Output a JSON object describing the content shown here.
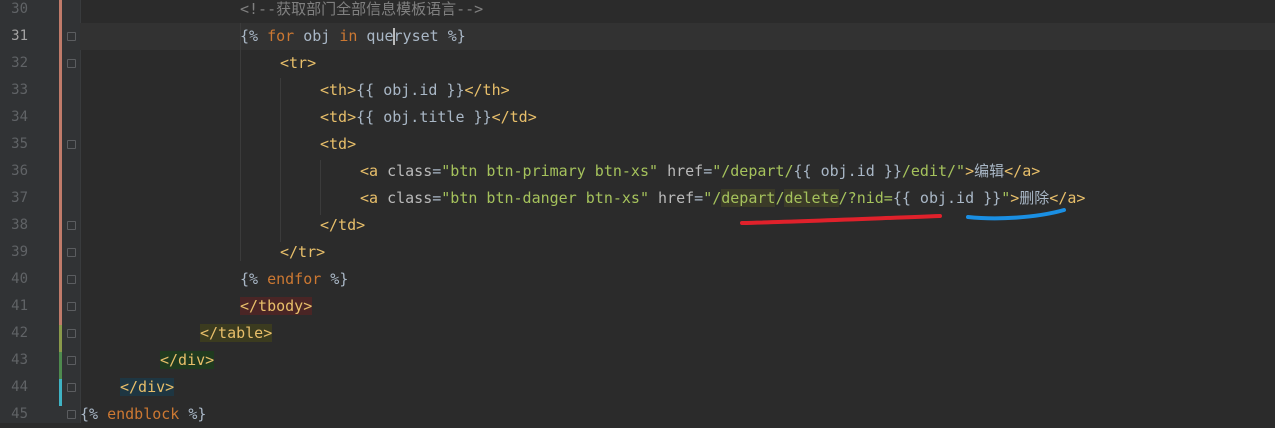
{
  "editor": {
    "current_line": 31,
    "line_numbers": [
      "30",
      "31",
      "32",
      "33",
      "34",
      "35",
      "36",
      "37",
      "38",
      "39",
      "40",
      "41",
      "42",
      "43",
      "44",
      "45"
    ],
    "lines": [
      {
        "segments": [
          [
            "comment",
            "<!--获取部门全部信息模板语言-->"
          ]
        ]
      },
      {
        "segments": [
          [
            "plain",
            "{% "
          ],
          [
            "kw",
            "for"
          ],
          [
            "plain",
            " obj "
          ],
          [
            "kw",
            "in"
          ],
          [
            "plain",
            " que"
          ],
          [
            "caret",
            ""
          ],
          [
            "plain",
            "ryset %}"
          ]
        ]
      },
      {
        "segments": [
          [
            "tag",
            "<tr>"
          ]
        ]
      },
      {
        "segments": [
          [
            "tag",
            "<th>"
          ],
          [
            "plain",
            "{{ obj.id }}"
          ],
          [
            "tag",
            "</th>"
          ]
        ]
      },
      {
        "segments": [
          [
            "tag",
            "<td>"
          ],
          [
            "plain",
            "{{ obj.title }}"
          ],
          [
            "tag",
            "</td>"
          ]
        ]
      },
      {
        "segments": [
          [
            "tag",
            "<td>"
          ]
        ]
      },
      {
        "segments": [
          [
            "tag",
            "<a "
          ],
          [
            "attr",
            "class"
          ],
          [
            "plain",
            "="
          ],
          [
            "val",
            "\"btn btn-primary btn-xs\""
          ],
          [
            "plain",
            " "
          ],
          [
            "attr",
            "href"
          ],
          [
            "plain",
            "="
          ],
          [
            "val",
            "\"/depart/"
          ],
          [
            "plain",
            "{{ obj.id }}"
          ],
          [
            "val",
            "/edit/\""
          ],
          [
            "tag",
            ">"
          ],
          [
            "plain",
            "编辑"
          ],
          [
            "tag",
            "</a>"
          ]
        ]
      },
      {
        "segments": [
          [
            "tag",
            "<a "
          ],
          [
            "attr",
            "class"
          ],
          [
            "plain",
            "="
          ],
          [
            "val",
            "\"btn btn-danger btn-xs\""
          ],
          [
            "plain",
            " "
          ],
          [
            "attr",
            "href"
          ],
          [
            "plain",
            "="
          ],
          [
            "val",
            "\"/"
          ],
          [
            "valhl",
            "depart"
          ],
          [
            "val",
            "/"
          ],
          [
            "valhl",
            "delete"
          ],
          [
            "val",
            "/?nid="
          ],
          [
            "plain",
            "{{ obj.id }}"
          ],
          [
            "val",
            "\""
          ],
          [
            "tag",
            ">"
          ],
          [
            "plain",
            "删除"
          ],
          [
            "tag",
            "</a>"
          ]
        ]
      },
      {
        "segments": [
          [
            "tag",
            "</td>"
          ]
        ]
      },
      {
        "segments": [
          [
            "tag",
            "</tr>"
          ]
        ]
      },
      {
        "segments": [
          [
            "plain",
            "{% "
          ],
          [
            "kw",
            "endfor"
          ],
          [
            "plain",
            " %}"
          ]
        ]
      },
      {
        "segments": [
          [
            "tbody",
            "</tbody>"
          ]
        ]
      },
      {
        "segments": [
          [
            "table",
            "</table>"
          ]
        ]
      },
      {
        "segments": [
          [
            "div1",
            "</div>"
          ]
        ]
      },
      {
        "segments": [
          [
            "div2",
            "</div>"
          ]
        ]
      },
      {
        "segments": [
          [
            "plain",
            "{% "
          ],
          [
            "kw",
            "endblock"
          ],
          [
            "plain",
            " %}"
          ]
        ]
      }
    ]
  },
  "annotations": {
    "underline_red_color": "#e0212b",
    "underline_blue_color": "#1a8fe3"
  },
  "icons": {
    "intention": "lightbulb-icon"
  }
}
